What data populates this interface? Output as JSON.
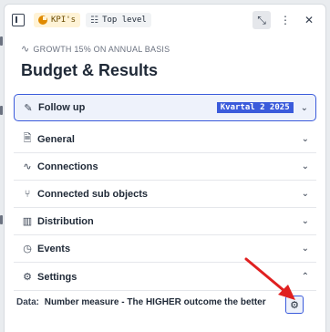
{
  "toolbar": {
    "kpi_chip": "KPI's",
    "level_chip": "Top level"
  },
  "header": {
    "subtitle": "GROWTH 15% ON ANNUAL BASIS",
    "title": "Budget & Results"
  },
  "sections": [
    {
      "label": "Follow up",
      "badge": "Kvartal 2 2025",
      "expanded": false
    },
    {
      "label": "General",
      "expanded": false
    },
    {
      "label": "Connections",
      "expanded": false
    },
    {
      "label": "Connected sub objects",
      "expanded": false
    },
    {
      "label": "Distribution",
      "expanded": false
    },
    {
      "label": "Events",
      "expanded": false
    },
    {
      "label": "Settings",
      "expanded": true
    }
  ],
  "settings": {
    "data_key": "Data:",
    "data_value": "Number measure - The HIGHER outcome the better"
  },
  "colors": {
    "accent": "#3b5bdb",
    "annotation_arrow": "#e02020",
    "kpi_chip_bg": "#fff3d6"
  }
}
